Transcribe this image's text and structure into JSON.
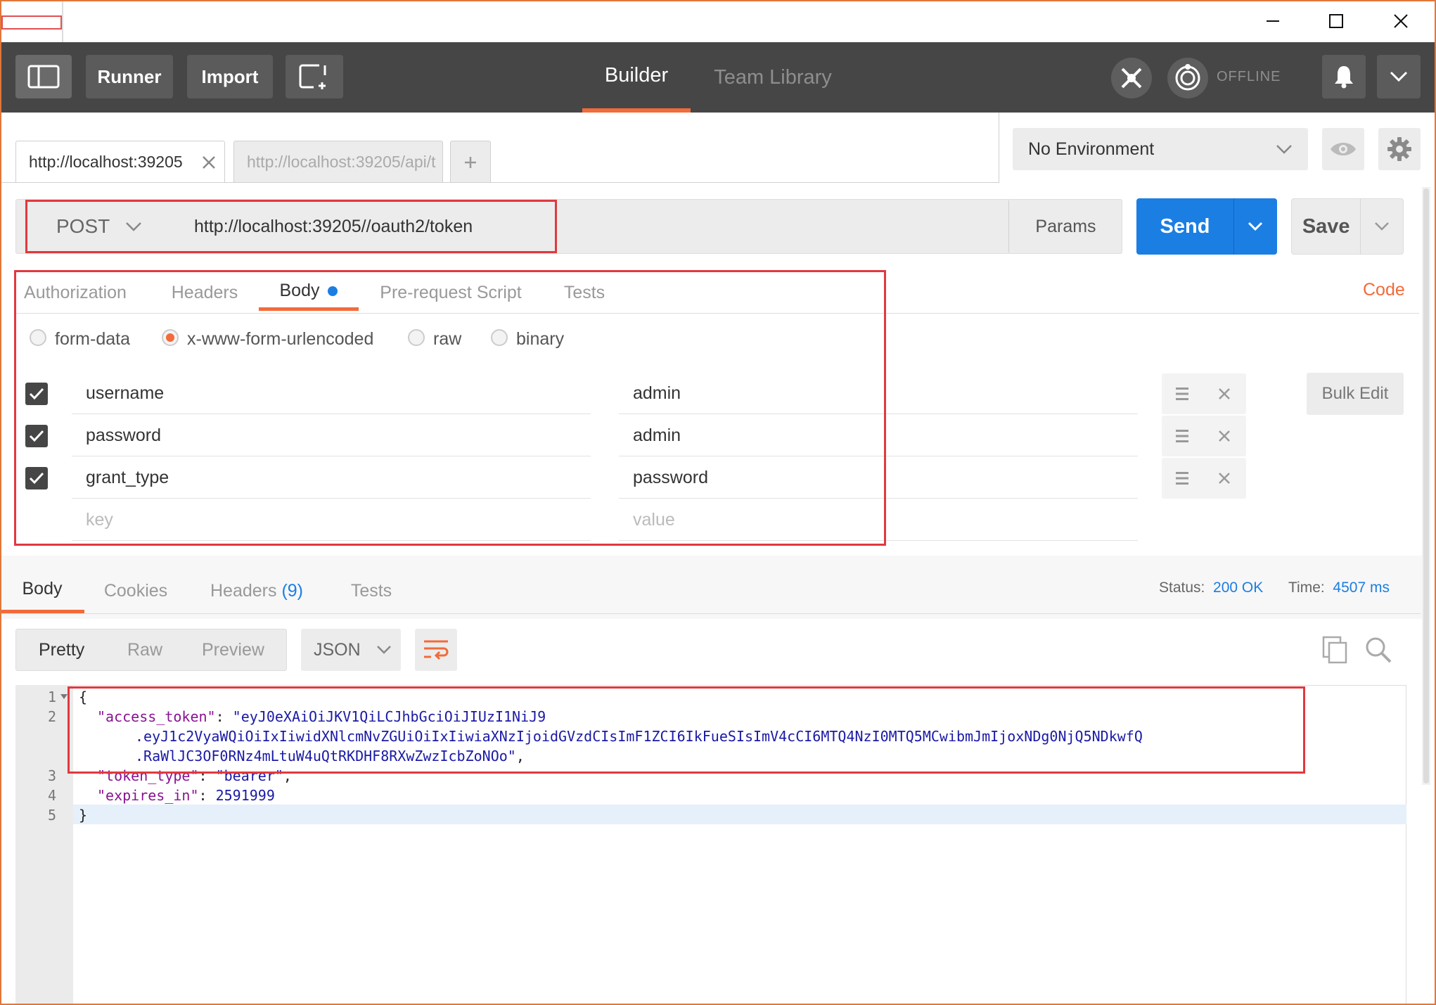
{
  "toolbar": {
    "runner": "Runner",
    "import": "Import",
    "nav": {
      "builder": "Builder",
      "team_library": "Team Library"
    },
    "status": "OFFLINE"
  },
  "tabs": [
    {
      "label": "http://localhost:39205",
      "active": true
    },
    {
      "label": "http://localhost:39205/api/t",
      "active": false
    }
  ],
  "environment": {
    "selected": "No Environment"
  },
  "request": {
    "method": "POST",
    "url": "http://localhost:39205//oauth2/token",
    "params": "Params",
    "send": "Send",
    "save": "Save"
  },
  "request_tabs": [
    "Authorization",
    "Headers",
    "Body",
    "Pre-request Script",
    "Tests"
  ],
  "code_link": "Code",
  "body_modes": [
    "form-data",
    "x-www-form-urlencoded",
    "raw",
    "binary"
  ],
  "body_mode_selected": "x-www-form-urlencoded",
  "form_rows": [
    {
      "key": "username",
      "value": "admin",
      "checked": true
    },
    {
      "key": "password",
      "value": "admin",
      "checked": true
    },
    {
      "key": "grant_type",
      "value": "password",
      "checked": true
    }
  ],
  "form_placeholder": {
    "key": "key",
    "value": "value"
  },
  "bulk_edit": "Bulk Edit",
  "response": {
    "tabs": {
      "body": "Body",
      "cookies": "Cookies",
      "headers": "Headers",
      "headers_count": "(9)",
      "tests": "Tests"
    },
    "status_label": "Status:",
    "status_value": "200 OK",
    "time_label": "Time:",
    "time_value": "4507 ms",
    "views": [
      "Pretty",
      "Raw",
      "Preview"
    ],
    "format": "JSON",
    "lines": [
      "1",
      "2",
      "3",
      "4",
      "5"
    ],
    "json": {
      "open": "{",
      "access_token_key": "\"access_token\"",
      "access_token_1": "\"eyJ0eXAiOiJKV1QiLCJhbGciOiJIUzI1NiJ9",
      "access_token_2": ".eyJ1c2VyaWQiOiIxIiwidXNlcmNvZGUiOiIxIiwiaXNzIjoidGVzdCIsImF1ZCI6IkFueSIsImV4cCI6MTQ4NzI0MTQ5MCwibmJmIjoxNDg0NjQ5NDkwfQ",
      "access_token_3": ".RaWlJC3OF0RNz4mLtuW4uQtRKDHF8RXwZwzIcbZoNOo\"",
      "token_type_key": "\"token_type\"",
      "token_type_val": "\"bearer\"",
      "expires_in_key": "\"expires_in\"",
      "expires_in_val": "2591999",
      "close": "}"
    }
  }
}
